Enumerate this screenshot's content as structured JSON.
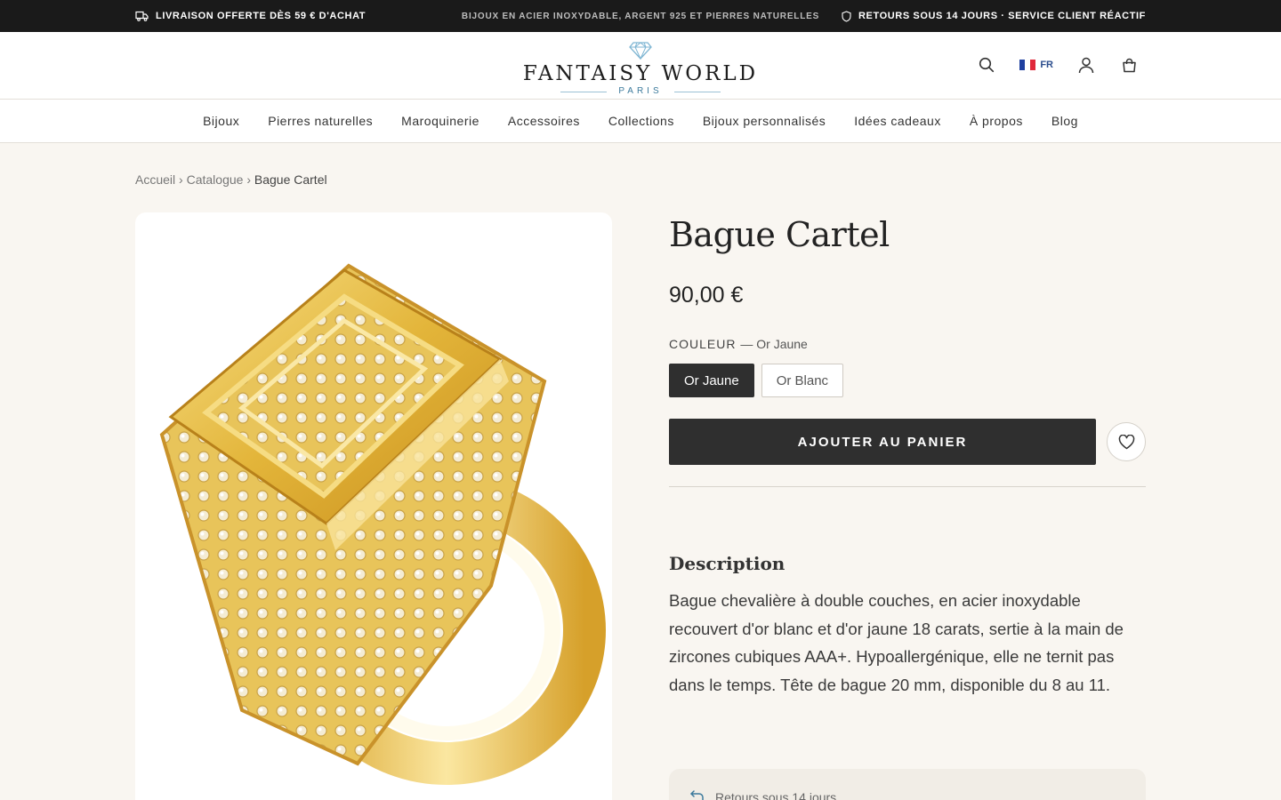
{
  "announcement": {
    "left": "LIVRAISON OFFERTE DÈS 59 € D'ACHAT",
    "center": "BIJOUX EN ACIER INOXYDABLE, ARGENT 925 ET PIERRES NATURELLES",
    "right": "RETOURS SOUS 14 JOURS · SERVICE CLIENT RÉACTIF"
  },
  "header": {
    "brand": "FANTAISY WORLD",
    "city": "PARIS",
    "lang": "FR"
  },
  "nav": {
    "items": [
      "Bijoux",
      "Pierres naturelles",
      "Maroquinerie",
      "Accessoires",
      "Collections",
      "Bijoux personnalisés",
      "Idées cadeaux",
      "À propos",
      "Blog"
    ]
  },
  "breadcrumb": {
    "home": "Accueil",
    "sep1": "›",
    "catalog": "Catalogue",
    "sep2": "›",
    "current": "Bague Cartel"
  },
  "product": {
    "title": "Bague Cartel",
    "price": "90,00 €",
    "option_label": "COULEUR",
    "option_value": "— Or Jaune",
    "options": [
      "Or Jaune",
      "Or Blanc"
    ],
    "selected_option": "Or Jaune",
    "add_to_cart": "AJOUTER AU PANIER",
    "description_title": "Description",
    "description": "Bague chevalière à double couches, en acier inoxydable recouvert d'or blanc et d'or jaune 18 carats, sertie à la main de zircones cubiques AAA+. Hypoallergénique, elle ne ternit pas dans le temps. Tête de bague 20 mm, disponible du 8 au 11.",
    "perk": "Retours sous 14 jours"
  },
  "colors": {
    "announce_bg": "#1a1a1a",
    "page_bg": "#f9f6f1",
    "button_dark": "#2f2f2f",
    "logo_accent": "#3c7a9c",
    "gold": "#e0b93a"
  }
}
